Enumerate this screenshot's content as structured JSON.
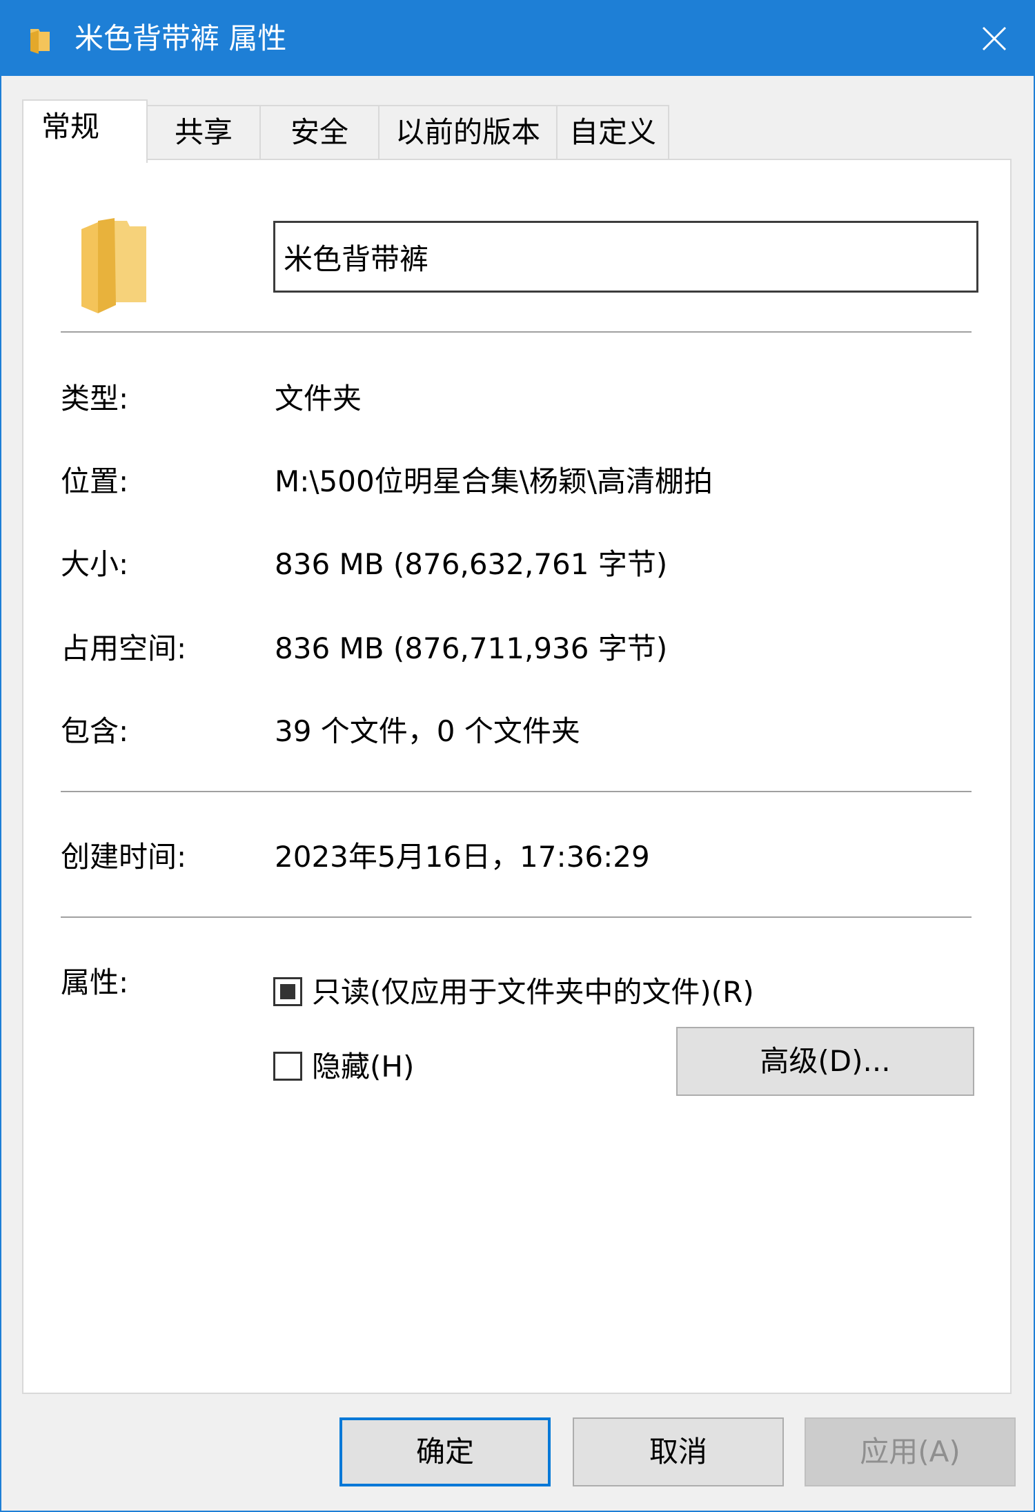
{
  "window": {
    "title": "米色背带裤 属性",
    "icon": "folder-icon",
    "close_icon": "close-icon"
  },
  "tabs": [
    {
      "label": "常规",
      "active": true
    },
    {
      "label": "共享",
      "active": false
    },
    {
      "label": "安全",
      "active": false
    },
    {
      "label": "以前的版本",
      "active": false
    },
    {
      "label": "自定义",
      "active": false
    }
  ],
  "general": {
    "folder_name": "米色背带裤",
    "type_label": "类型:",
    "type_value": "文件夹",
    "location_label": "位置:",
    "location_value": "M:\\500位明星合集\\杨颖\\高清棚拍",
    "size_label": "大小:",
    "size_value": "836 MB (876,632,761 字节)",
    "size_on_disk_label": "占用空间:",
    "size_on_disk_value": "836 MB (876,711,936 字节)",
    "contains_label": "包含:",
    "contains_value": "39 个文件，0 个文件夹",
    "created_label": "创建时间:",
    "created_value": "2023年5月16日，17:36:29",
    "attributes_label": "属性:",
    "readonly_label": "只读(仅应用于文件夹中的文件)(R)",
    "readonly_state": "indeterminate",
    "hidden_label": "隐藏(H)",
    "hidden_state": "unchecked",
    "advanced_button": "高级(D)..."
  },
  "footer": {
    "ok_button": "确定",
    "cancel_button": "取消",
    "apply_button": "应用(A)"
  },
  "colors": {
    "titlebar": "#1e7fd6",
    "accent": "#0078d7",
    "folder": "#f4c45a"
  }
}
